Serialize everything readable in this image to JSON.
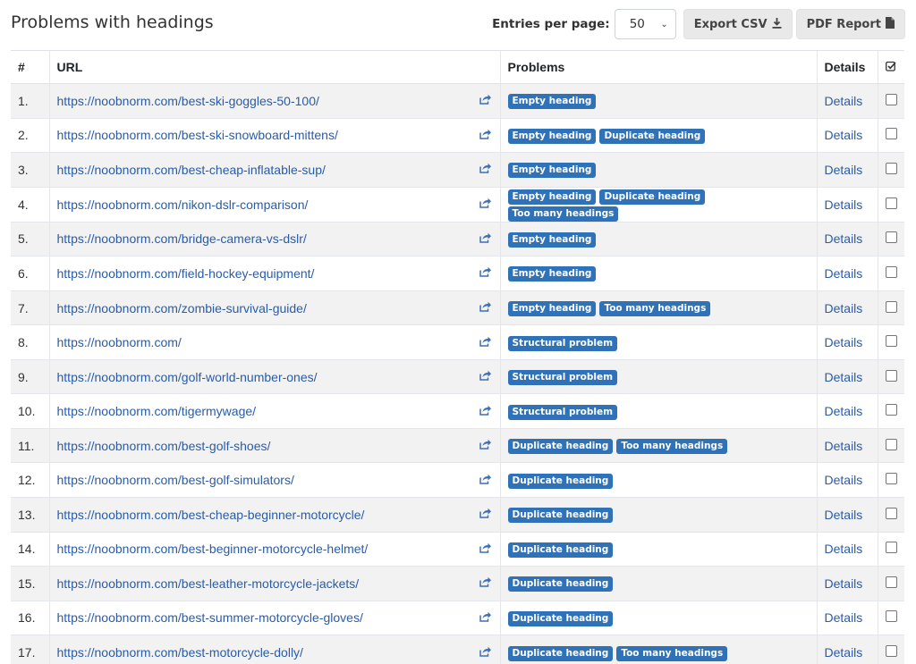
{
  "header": {
    "title": "Problems with headings",
    "entries_label": "Entries per page:",
    "entries_value": "50",
    "export_csv_label": "Export CSV",
    "pdf_report_label": "PDF Report"
  },
  "table": {
    "columns": {
      "num": "#",
      "url": "URL",
      "problems": "Problems",
      "details": "Details"
    },
    "rows": [
      {
        "num": "1.",
        "url": "https://noobnorm.com/best-ski-goggles-50-100/",
        "problems": [
          "Empty heading"
        ],
        "details": "Details"
      },
      {
        "num": "2.",
        "url": "https://noobnorm.com/best-ski-snowboard-mittens/",
        "problems": [
          "Empty heading",
          "Duplicate heading"
        ],
        "details": "Details"
      },
      {
        "num": "3.",
        "url": "https://noobnorm.com/best-cheap-inflatable-sup/",
        "problems": [
          "Empty heading"
        ],
        "details": "Details"
      },
      {
        "num": "4.",
        "url": "https://noobnorm.com/nikon-dslr-comparison/",
        "problems": [
          "Empty heading",
          "Duplicate heading",
          "Too many headings"
        ],
        "details": "Details"
      },
      {
        "num": "5.",
        "url": "https://noobnorm.com/bridge-camera-vs-dslr/",
        "problems": [
          "Empty heading"
        ],
        "details": "Details"
      },
      {
        "num": "6.",
        "url": "https://noobnorm.com/field-hockey-equipment/",
        "problems": [
          "Empty heading"
        ],
        "details": "Details"
      },
      {
        "num": "7.",
        "url": "https://noobnorm.com/zombie-survival-guide/",
        "problems": [
          "Empty heading",
          "Too many headings"
        ],
        "details": "Details"
      },
      {
        "num": "8.",
        "url": "https://noobnorm.com/",
        "problems": [
          "Structural problem"
        ],
        "details": "Details"
      },
      {
        "num": "9.",
        "url": "https://noobnorm.com/golf-world-number-ones/",
        "problems": [
          "Structural problem"
        ],
        "details": "Details"
      },
      {
        "num": "10.",
        "url": "https://noobnorm.com/tigermywage/",
        "problems": [
          "Structural problem"
        ],
        "details": "Details"
      },
      {
        "num": "11.",
        "url": "https://noobnorm.com/best-golf-shoes/",
        "problems": [
          "Duplicate heading",
          "Too many headings"
        ],
        "details": "Details"
      },
      {
        "num": "12.",
        "url": "https://noobnorm.com/best-golf-simulators/",
        "problems": [
          "Duplicate heading"
        ],
        "details": "Details"
      },
      {
        "num": "13.",
        "url": "https://noobnorm.com/best-cheap-beginner-motorcycle/",
        "problems": [
          "Duplicate heading"
        ],
        "details": "Details"
      },
      {
        "num": "14.",
        "url": "https://noobnorm.com/best-beginner-motorcycle-helmet/",
        "problems": [
          "Duplicate heading"
        ],
        "details": "Details"
      },
      {
        "num": "15.",
        "url": "https://noobnorm.com/best-leather-motorcycle-jackets/",
        "problems": [
          "Duplicate heading"
        ],
        "details": "Details"
      },
      {
        "num": "16.",
        "url": "https://noobnorm.com/best-summer-motorcycle-gloves/",
        "problems": [
          "Duplicate heading"
        ],
        "details": "Details"
      },
      {
        "num": "17.",
        "url": "https://noobnorm.com/best-motorcycle-dolly/",
        "problems": [
          "Duplicate heading",
          "Too many headings"
        ],
        "details": "Details"
      }
    ]
  },
  "colors": {
    "badge": "#3072b7",
    "link": "#2a5ca8",
    "stripe": "#f2f2f2"
  },
  "icons": {
    "export": "download-icon",
    "pdf": "file-icon",
    "external": "external-link-icon",
    "select_all": "check-square-icon"
  }
}
